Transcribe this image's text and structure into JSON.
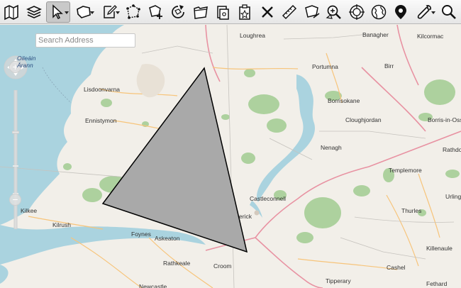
{
  "toolbar": {
    "buttons": [
      {
        "name": "map-layers-icon",
        "active": false,
        "menu": false
      },
      {
        "name": "layers-stack-icon",
        "active": false,
        "menu": false
      },
      {
        "name": "select-pointer-icon",
        "active": true,
        "menu": true
      },
      {
        "name": "polygon-draw-icon",
        "active": false,
        "menu": true
      },
      {
        "name": "edit-pencil-icon",
        "active": false,
        "menu": true
      },
      {
        "name": "polygon-vertex-icon",
        "active": false,
        "menu": false
      },
      {
        "name": "add-polygon-icon",
        "active": false,
        "menu": false
      },
      {
        "name": "rotate-icon",
        "active": false,
        "menu": false
      },
      {
        "name": "folder-icon",
        "active": false,
        "menu": false
      },
      {
        "name": "copy-icon",
        "active": false,
        "menu": false
      },
      {
        "name": "paste-icon",
        "active": false,
        "menu": false
      },
      {
        "name": "delete-x-icon",
        "active": false,
        "menu": false
      },
      {
        "name": "ruler-icon",
        "active": false,
        "menu": false
      },
      {
        "name": "measure-area-icon",
        "active": false,
        "menu": false
      },
      {
        "name": "zoom-to-icon",
        "active": false,
        "menu": false
      },
      {
        "name": "target-icon",
        "active": false,
        "menu": false
      },
      {
        "name": "globe-icon",
        "active": false,
        "menu": false
      },
      {
        "name": "location-pin-icon",
        "active": false,
        "menu": false
      },
      {
        "name": "wrench-icon",
        "active": false,
        "menu": true
      },
      {
        "name": "search-icon",
        "active": false,
        "menu": false
      }
    ]
  },
  "search": {
    "placeholder": "Search Address"
  },
  "places": [
    {
      "id": "loughrea",
      "label": "Loughrea"
    },
    {
      "id": "banagher",
      "label": "Banagher"
    },
    {
      "id": "kilcormac",
      "label": "Kilcormac"
    },
    {
      "id": "oilean-arann",
      "label": "Oileáin\nÁrann"
    },
    {
      "id": "portumna",
      "label": "Portumna"
    },
    {
      "id": "birr",
      "label": "Birr"
    },
    {
      "id": "lisdoonvarna",
      "label": "Lisdoonvarna"
    },
    {
      "id": "borrisokane",
      "label": "Borrisokane"
    },
    {
      "id": "ennistymon",
      "label": "Ennistymon"
    },
    {
      "id": "cloughjordan",
      "label": "Cloughjordan"
    },
    {
      "id": "borris-in-ossory",
      "label": "Borris-in-Oss"
    },
    {
      "id": "nenagh",
      "label": "Nenagh"
    },
    {
      "id": "rathdowney",
      "label": "Rathdo"
    },
    {
      "id": "templemore",
      "label": "Templemore"
    },
    {
      "id": "castleconnell",
      "label": "Castleconnell"
    },
    {
      "id": "urlingford",
      "label": "Urling"
    },
    {
      "id": "kilkee",
      "label": "Kilkee"
    },
    {
      "id": "limerick",
      "label": "erick"
    },
    {
      "id": "thurles",
      "label": "Thurles"
    },
    {
      "id": "kilrush",
      "label": "Kilrush"
    },
    {
      "id": "foynes",
      "label": "Foynes"
    },
    {
      "id": "askeaton",
      "label": "Askeaton"
    },
    {
      "id": "killenaule",
      "label": "Killenaule"
    },
    {
      "id": "rathkeale",
      "label": "Rathkeale"
    },
    {
      "id": "croom",
      "label": "Croom"
    },
    {
      "id": "cashel",
      "label": "Cashel"
    },
    {
      "id": "tipperary",
      "label": "Tipperary"
    },
    {
      "id": "newcastle",
      "label": "Newcastle"
    },
    {
      "id": "fethard",
      "label": "Fethard"
    }
  ],
  "drawn_shape": {
    "type": "triangle",
    "fill": "#a9a9a9",
    "stroke": "#000000"
  },
  "colors": {
    "land": "#f2efe9",
    "water": "#aad3df",
    "forest": "#add19e",
    "primary_road": "#e892a2",
    "secondary_road": "#f7c47a"
  }
}
